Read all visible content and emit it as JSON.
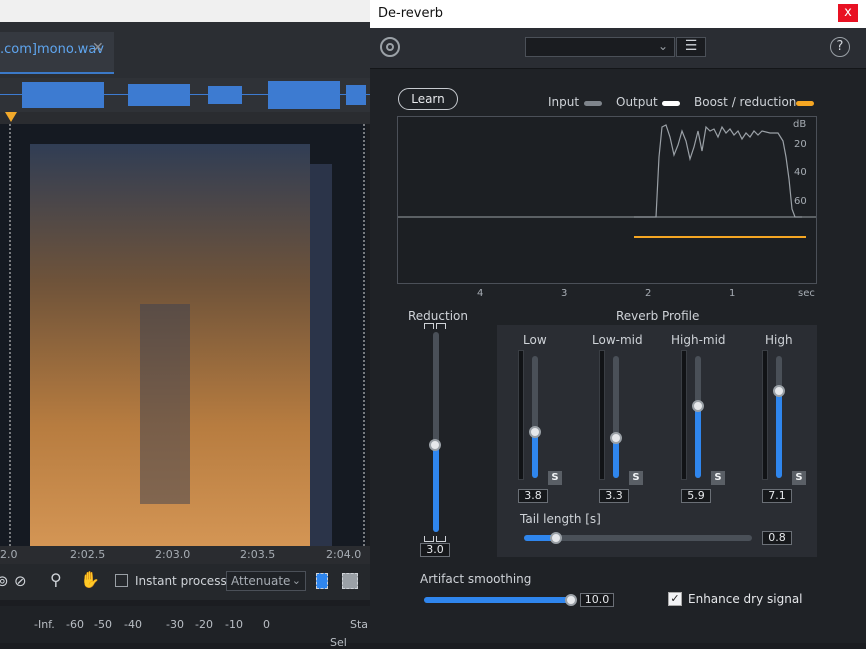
{
  "host": {
    "tab_label": ".com]mono.wav",
    "time_ticks": [
      "2.0",
      "2:02.5",
      "2:03.0",
      "2:03.5",
      "2:04.0"
    ],
    "instant_process_label": "Instant process",
    "mode_select_value": "Attenuate",
    "meter_ticks": [
      "-Inf.",
      "-60",
      "-50",
      "-40",
      "-30",
      "-20",
      "-10",
      "0"
    ],
    "meter_right_top": "Sta",
    "meter_right_bottom": "Sel"
  },
  "plugin": {
    "title": "De-reverb",
    "close_label": "x",
    "help_label": "?",
    "learn_label": "Learn",
    "legend": {
      "input": "Input",
      "output": "Output",
      "boost": "Boost / reduction",
      "input_color": "#7f858c",
      "output_color": "#ffffff",
      "boost_color": "#f5a623"
    },
    "graph": {
      "db_unit": "dB",
      "db_ticks": [
        "20",
        "40",
        "60"
      ],
      "time_ticks": [
        "4",
        "3",
        "2",
        "1"
      ],
      "time_unit": "sec"
    },
    "reduction": {
      "label": "Reduction",
      "value": "3.0",
      "level": 0.44
    },
    "profile": {
      "label": "Reverb Profile",
      "bands": [
        {
          "name": "Low",
          "value": "3.8",
          "level": 0.38,
          "solo": "S"
        },
        {
          "name": "Low-mid",
          "value": "3.3",
          "level": 0.33,
          "solo": "S"
        },
        {
          "name": "High-mid",
          "value": "5.9",
          "level": 0.59,
          "solo": "S"
        },
        {
          "name": "High",
          "value": "7.1",
          "level": 0.71,
          "solo": "S"
        }
      ],
      "tail": {
        "label": "Tail length [s]",
        "value": "0.8",
        "level": 0.14
      }
    },
    "artifact": {
      "label": "Artifact smoothing",
      "value": "10.0",
      "level": 1.0
    },
    "enhance": {
      "label": "Enhance dry signal",
      "checked": true,
      "check": "✓"
    },
    "accent_color": "#2f86ee"
  }
}
